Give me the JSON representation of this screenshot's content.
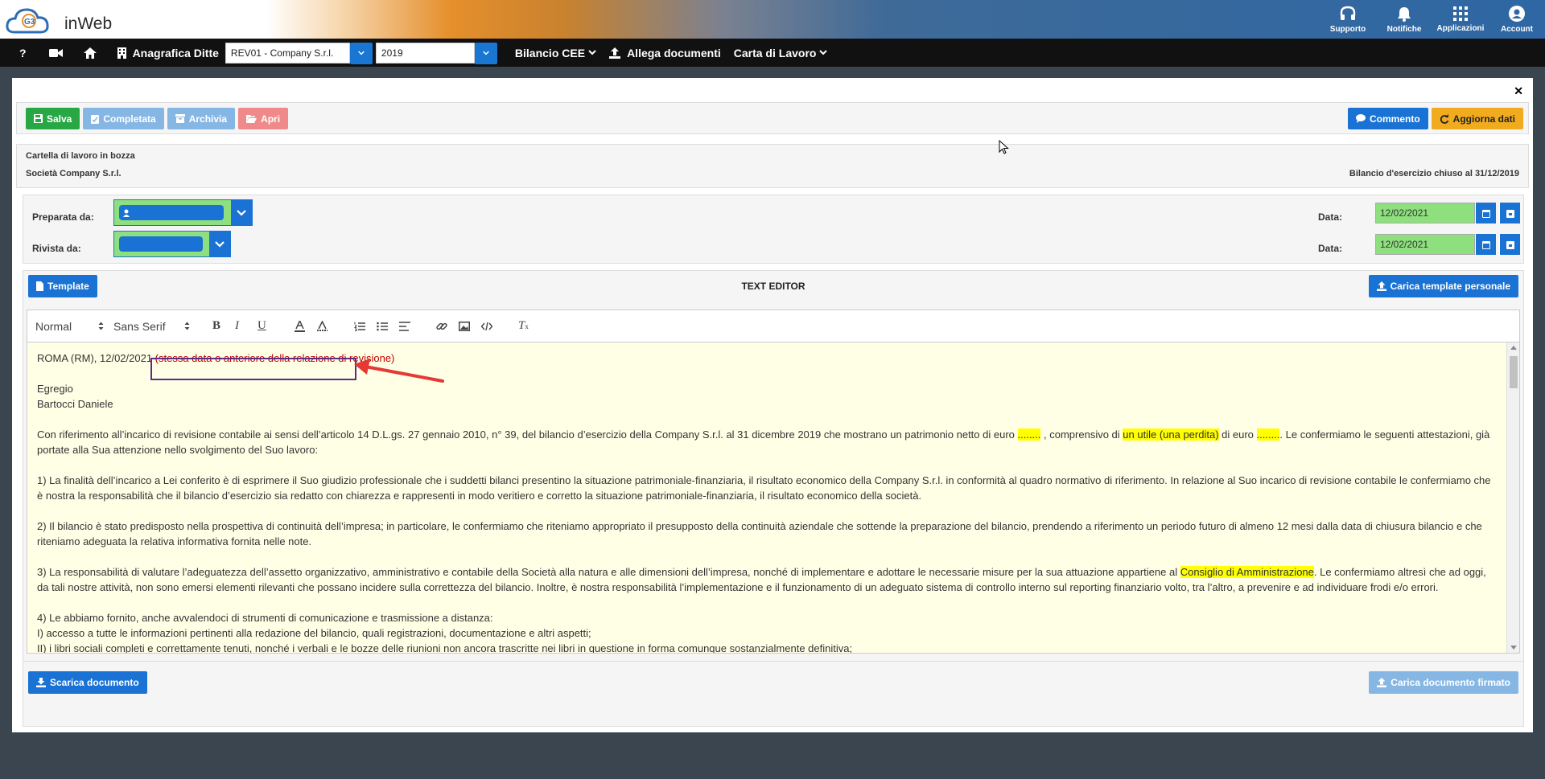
{
  "app": {
    "logo_text": "inWeb",
    "logo_badge": "G3"
  },
  "top_icons": [
    {
      "label": "Supporto",
      "icon": "headset-icon"
    },
    {
      "label": "Notifiche",
      "icon": "bell-icon"
    },
    {
      "label": "Applicazioni",
      "icon": "grid-icon"
    },
    {
      "label": "Account",
      "icon": "user-circle-icon"
    }
  ],
  "nav": {
    "help": "?",
    "anagrafica": "Anagrafica Ditte",
    "company_select": "REV01 - Company S.r.l.",
    "year_select": "2019",
    "bilancio": "Bilancio CEE",
    "allega": "Allega documenti",
    "carta": "Carta di Lavoro"
  },
  "actions": {
    "salva": "Salva",
    "completata": "Completata",
    "archivia": "Archivia",
    "apri": "Apri",
    "commento": "Commento",
    "aggiorna": "Aggiorna dati"
  },
  "info": {
    "status": "Cartella di lavoro in bozza",
    "company": "Società Company S.r.l.",
    "bilancio": "Bilancio d'esercizio chiuso al 31/12/2019"
  },
  "review": {
    "preparata_label": "Preparata da:",
    "rivista_label": "Rivista da:",
    "data_label": "Data:",
    "data_preparata": "12/02/2021",
    "data_rivista": "12/02/2021"
  },
  "editor_header": {
    "template": "Template",
    "title": "TEXT EDITOR",
    "carica_template": "Carica template personale"
  },
  "toolbar": {
    "format": "Normal",
    "font": "Sans Serif"
  },
  "doc": {
    "l1a": "ROMA (RM), 12/02/2021 ",
    "l1b": "(stessa data o anteriore della relazione di revisione)",
    "l2": "Egregio",
    "l3": "Bartocci Daniele",
    "p1a": "Con riferimento all’incarico di revisione contabile ai sensi dell’articolo 14 D.L.gs. 27 gennaio 2010, n° 39, del bilancio d’esercizio della Company S.r.l. al 31 dicembre 2019 che mostrano un patrimonio netto di euro ",
    "p1h1": "........",
    "p1b": " , comprensivo di ",
    "p1h2": "un utile (una perdita)",
    "p1c": " di euro ",
    "p1h3": "........",
    "p1d": ". Le confermiamo le seguenti attestazioni, già portate alla Sua attenzione nello svolgimento del Suo lavoro:",
    "p2": "1) La finalità dell’incarico a Lei conferito è di esprimere il Suo giudizio professionale che i suddetti bilanci presentino la situazione patrimoniale-finanziaria, il risultato economico della Company S.r.l. in conformità al quadro normativo di riferimento. In relazione al Suo incarico di revisione contabile le confermiamo che è nostra la responsabilità che il bilancio d’esercizio sia redatto con chiarezza e rappresenti in modo veritiero e corretto la situazione patrimoniale-finanziaria, il risultato economico della società.",
    "p3": "2) Il bilancio è stato predisposto nella prospettiva di continuità dell’impresa; in particolare, le confermiamo che riteniamo appropriato il presupposto della continuità aziendale che sottende la preparazione del bilancio, prendendo a riferimento un periodo futuro di almeno 12 mesi dalla data di chiusura bilancio e che riteniamo adeguata la relativa informativa fornita nelle note.",
    "p4a": "3) La responsabilità di valutare l’adeguatezza dell’assetto organizzativo, amministrativo e contabile della Società alla natura e alle dimensioni dell’impresa, nonché di implementare e adottare le necessarie misure per la sua attuazione appartiene al ",
    "p4h": "Consiglio di Amministrazione",
    "p4b": ". Le confermiamo altresì che ad oggi, da tali nostre attività, non sono emersi elementi rilevanti che possano incidere sulla correttezza del bilancio. Inoltre, è nostra responsabilità l’implementazione e il funzionamento di un adeguato sistema di controllo interno sul reporting finanziario volto, tra l’altro, a prevenire e ad individuare frodi e/o errori.",
    "p5": "4) Le abbiamo fornito, anche avvalendoci di strumenti di comunicazione e trasmissione a distanza:",
    "p6": "I)  accesso a tutte le informazioni pertinenti alla redazione del bilancio, quali registrazioni, documentazione e altri aspetti;",
    "p7": "II) i libri sociali completi e correttamente tenuti, nonché i verbali e le bozze delle riunioni non ancora trascritte nei libri in questione in forma comunque sostanzialmente definitiva;"
  },
  "footer": {
    "scarica": "Scarica documento",
    "carica_firmato": "Carica documento firmato"
  },
  "colors": {
    "accent": "#1a73d4",
    "success": "#28a745",
    "warning": "#f0ac1e",
    "highlight": "#ffff00",
    "annotation": "#e53935"
  }
}
